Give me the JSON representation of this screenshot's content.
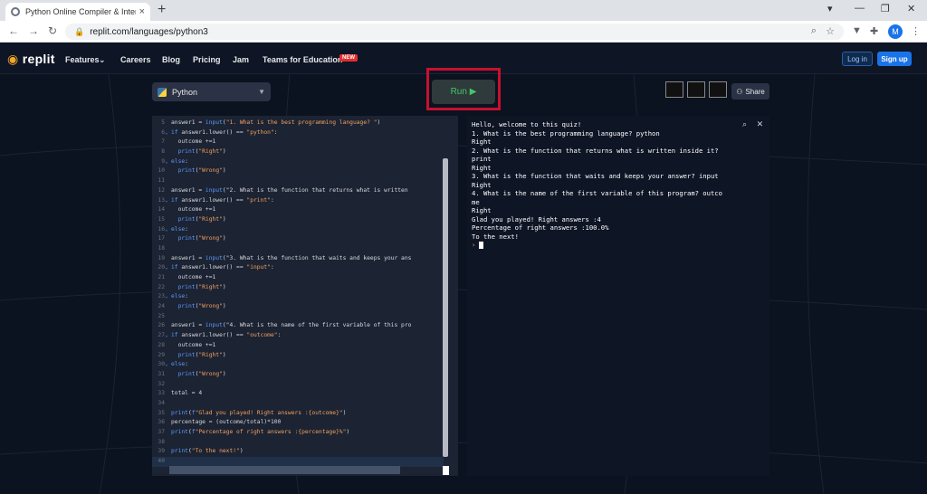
{
  "browser": {
    "tab_title": "Python Online Compiler & Interp",
    "tab_close": "×",
    "new_tab": "+",
    "url": "replit.com/languages/python3",
    "avatar_letter": "M"
  },
  "header": {
    "logo_text": "replit",
    "nav": [
      "Features",
      "Careers",
      "Blog",
      "Pricing",
      "Jam",
      "Teams for Education"
    ],
    "badge": "NEW",
    "login": "Log in",
    "signup": "Sign up"
  },
  "workspace": {
    "language": "Python",
    "run_label": "Run ▶",
    "share_label": "Share"
  },
  "editor": {
    "lines": [
      {
        "n": "5",
        "f": "",
        "t": "answer1 = input(\"1. What is the best programming language? \")"
      },
      {
        "n": "6",
        "f": "⌄",
        "t": "if answer1.lower() == \"python\":"
      },
      {
        "n": "7",
        "f": "",
        "t": "  outcome +=1"
      },
      {
        "n": "8",
        "f": "",
        "t": "  print(\"Right\")"
      },
      {
        "n": "9",
        "f": "⌄",
        "t": "else:"
      },
      {
        "n": "10",
        "f": "",
        "t": "  print(\"Wrong\")"
      },
      {
        "n": "11",
        "f": "",
        "t": ""
      },
      {
        "n": "12",
        "f": "",
        "t": "answer1 = input(\"2. What is the function that returns what is written"
      },
      {
        "n": "13",
        "f": "⌄",
        "t": "if answer1.lower() == \"print\":"
      },
      {
        "n": "14",
        "f": "",
        "t": "  outcome +=1"
      },
      {
        "n": "15",
        "f": "",
        "t": "  print(\"Right\")"
      },
      {
        "n": "16",
        "f": "⌄",
        "t": "else:"
      },
      {
        "n": "17",
        "f": "",
        "t": "  print(\"Wrong\")"
      },
      {
        "n": "18",
        "f": "",
        "t": ""
      },
      {
        "n": "19",
        "f": "",
        "t": "answer1 = input(\"3. What is the function that waits and keeps your ans"
      },
      {
        "n": "20",
        "f": "⌄",
        "t": "if answer1.lower() == \"input\":"
      },
      {
        "n": "21",
        "f": "",
        "t": "  outcome +=1"
      },
      {
        "n": "22",
        "f": "",
        "t": "  print(\"Right\")"
      },
      {
        "n": "23",
        "f": "⌄",
        "t": "else:"
      },
      {
        "n": "24",
        "f": "",
        "t": "  print(\"Wrong\")"
      },
      {
        "n": "25",
        "f": "",
        "t": ""
      },
      {
        "n": "26",
        "f": "",
        "t": "answer1 = input(\"4. What is the name of the first variable of this pro"
      },
      {
        "n": "27",
        "f": "⌄",
        "t": "if answer1.lower() == \"outcome\":"
      },
      {
        "n": "28",
        "f": "",
        "t": "  outcome +=1"
      },
      {
        "n": "29",
        "f": "",
        "t": "  print(\"Right\")"
      },
      {
        "n": "30",
        "f": "⌄",
        "t": "else:"
      },
      {
        "n": "31",
        "f": "",
        "t": "  print(\"Wrong\")"
      },
      {
        "n": "32",
        "f": "",
        "t": ""
      },
      {
        "n": "33",
        "f": "",
        "t": "total = 4"
      },
      {
        "n": "34",
        "f": "",
        "t": ""
      },
      {
        "n": "35",
        "f": "",
        "t": "print(f\"Glad you played! Right answers :{outcome}\")"
      },
      {
        "n": "36",
        "f": "",
        "t": "percentage = (outcome/total)*100"
      },
      {
        "n": "37",
        "f": "",
        "t": "print(f\"Percentage of right answers :{percentage}%\")"
      },
      {
        "n": "38",
        "f": "",
        "t": ""
      },
      {
        "n": "39",
        "f": "",
        "t": "print(\"To the next!\")"
      },
      {
        "n": "40",
        "f": "",
        "t": ""
      }
    ]
  },
  "console": {
    "lines": [
      "Hello, welcome to this quiz!",
      "1. What is the best programming language? python",
      "Right",
      "2. What is the function that returns what is written inside it?",
      "print",
      "Right",
      "3. What is the function that waits and keeps your answer? input",
      "Right",
      "4. What is the name of the first variable of this program? outco",
      "me",
      "Right",
      "Glad you played! Right answers :4",
      "Percentage of right answers :100.0%",
      "To the next!"
    ],
    "prompt": "›"
  }
}
